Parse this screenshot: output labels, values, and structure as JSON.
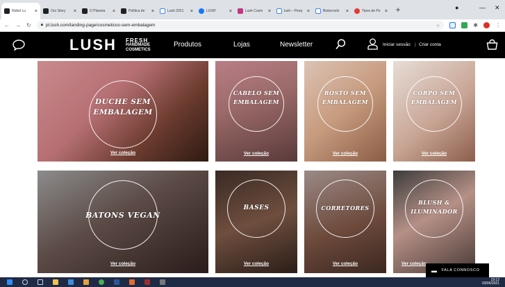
{
  "browser": {
    "tabs": [
      {
        "label": "Nobel Lu",
        "color": "#202124"
      },
      {
        "label": "Our Story",
        "color": "#202124"
      },
      {
        "label": "O Planeta",
        "color": "#202124"
      },
      {
        "label": "Política de",
        "color": "#202124"
      },
      {
        "label": "Lush 2021",
        "color": "#4285f4"
      },
      {
        "label": "LUSH",
        "color": "#1877f2"
      },
      {
        "label": "Lush Cosm",
        "color": "#c13584"
      },
      {
        "label": "lush – Pesq",
        "color": "#4285f4"
      },
      {
        "label": "Biotecnolo",
        "color": "#4285f4"
      },
      {
        "label": "Tipos de Pe",
        "color": "#e53935"
      }
    ],
    "url": "pt.lush.com/landing-page/cosmeticos-sem-embalagem"
  },
  "header": {
    "logo": "LUSH",
    "logo_fresh": "FRESH",
    "logo_handmade": "HANDMADE",
    "logo_cosmetics": "COSMETICS",
    "nav": [
      "Produtos",
      "Lojas",
      "Newsletter"
    ],
    "login": "Iniciar sessão",
    "create": "Criar conta"
  },
  "tiles": [
    {
      "title_lines": [
        "DUCHE SEM",
        "EMBALAGEM"
      ],
      "link": "Ver coleção",
      "bg": "linear-gradient(135deg,#c98a8e 0%,#b56f72 40%,#6b3b2e 70%,#2e1a12 100%)"
    },
    {
      "title_lines": [
        "CABELO SEM",
        "EMBALAGEM"
      ],
      "link": "Ver coleção",
      "bg": "linear-gradient(160deg,#b97e86 0%,#9c6b6a 40%,#5a3a3a 100%)"
    },
    {
      "title_lines": [
        "ROSTO SEM",
        "EMBALAGEM"
      ],
      "link": "Ver coleção",
      "bg": "linear-gradient(140deg,#dcc3b4 0%,#c69a7d 50%,#8a5d45 100%)"
    },
    {
      "title_lines": [
        "CORPO SEM",
        "EMBALAGEM"
      ],
      "link": "Ver coleção",
      "bg": "linear-gradient(140deg,#e7ddd6 0%,#c8a595 55%,#8d5e4c 100%)"
    },
    {
      "title_lines": [
        "BATONS VEGAN"
      ],
      "link": "Ver coleção",
      "bg": "linear-gradient(150deg,#8c8c8c 0%,#5b4a45 45%,#2a1c19 100%)"
    },
    {
      "title_lines": [
        "BASES"
      ],
      "link": "Ver coleção",
      "bg": "linear-gradient(160deg,#3a2a24 0%,#6e4e3e 50%,#2b1d18 100%)"
    },
    {
      "title_lines": [
        "CORRETORES"
      ],
      "link": "Ver coleção",
      "bg": "linear-gradient(160deg,#9b8a86 0%,#6d4a3c 55%,#3b2720 100%)"
    },
    {
      "title_lines": [
        "BLUSH &",
        "ILUMINADOR"
      ],
      "link": "Ver coleção",
      "bg": "linear-gradient(150deg,#3c3c3c 0%,#b59086 45%,#4a3a36 100%)"
    }
  ],
  "chat_label": "FALA CONNOSCO",
  "tray": {
    "time": "19:12",
    "date": "03/06/2021"
  }
}
